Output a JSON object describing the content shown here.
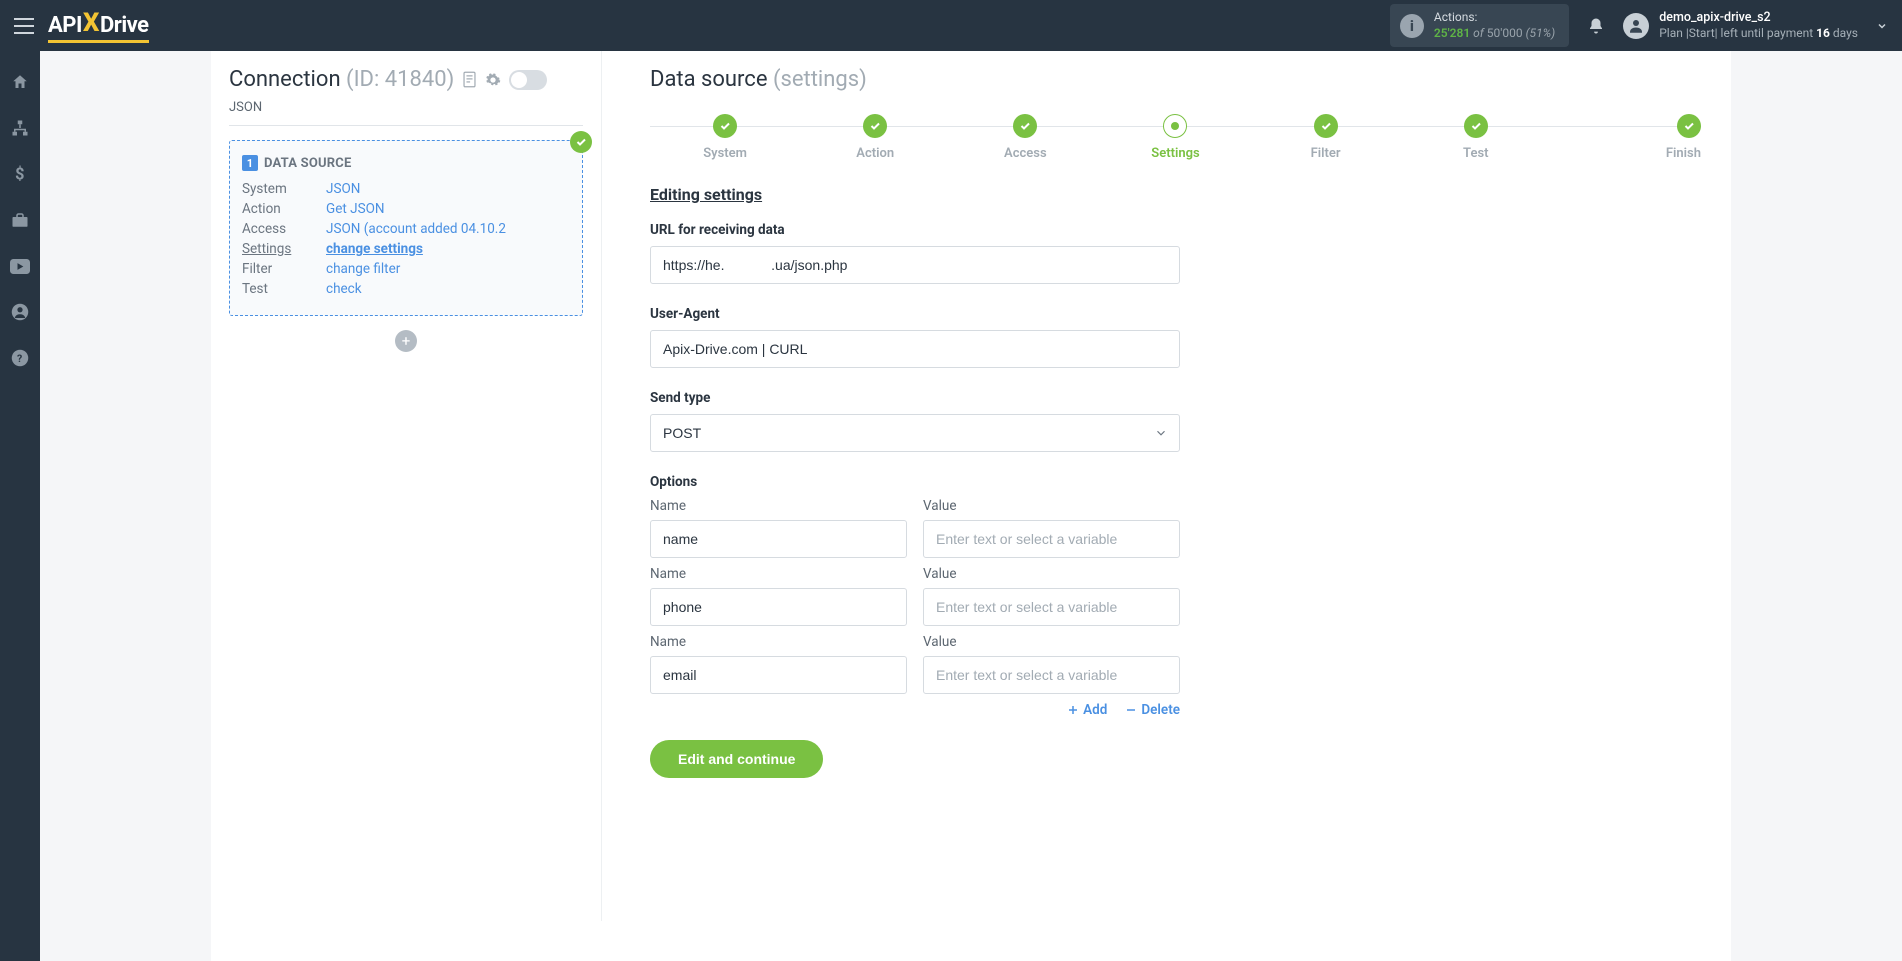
{
  "header": {
    "logo_text_1": "API",
    "logo_text_2": "Drive",
    "actions": {
      "label": "Actions:",
      "count": "25'281",
      "of": " of ",
      "limit": "50'000 ",
      "pct": "(51%)"
    },
    "user": {
      "name": "demo_apix-drive_s2",
      "plan_prefix": "Plan  |Start|  left until payment ",
      "days": "16",
      "days_suffix": " days"
    }
  },
  "connection": {
    "title": "Connection ",
    "id_label": "(ID: 41840)",
    "subtitle": "JSON",
    "card": {
      "badge": "1",
      "title": "DATA SOURCE",
      "rows": {
        "system_lab": "System",
        "system_val": "JSON",
        "action_lab": "Action",
        "action_val": "Get JSON",
        "access_lab": "Access",
        "access_val": "JSON (account added 04.10.2",
        "settings_lab": "Settings",
        "settings_val": "change settings",
        "filter_lab": "Filter",
        "filter_val": "change filter",
        "test_lab": "Test",
        "test_val": "check"
      }
    }
  },
  "page": {
    "title": "Data source ",
    "title_sub": "(settings)",
    "steps": [
      "System",
      "Action",
      "Access",
      "Settings",
      "Filter",
      "Test",
      "Finish"
    ],
    "section_heading": "Editing settings",
    "form": {
      "url_label": "URL for receiving data",
      "url_value": "https://he.            .ua/json.php",
      "ua_label": "User-Agent",
      "ua_value": "Apix-Drive.com | CURL",
      "sendtype_label": "Send type",
      "sendtype_value": "POST",
      "options_heading": "Options",
      "name_label": "Name",
      "value_label": "Value",
      "value_placeholder": "Enter text or select a variable",
      "rows": [
        "name",
        "phone",
        "email"
      ],
      "add": "Add",
      "delete": "Delete"
    },
    "submit": "Edit and continue"
  }
}
